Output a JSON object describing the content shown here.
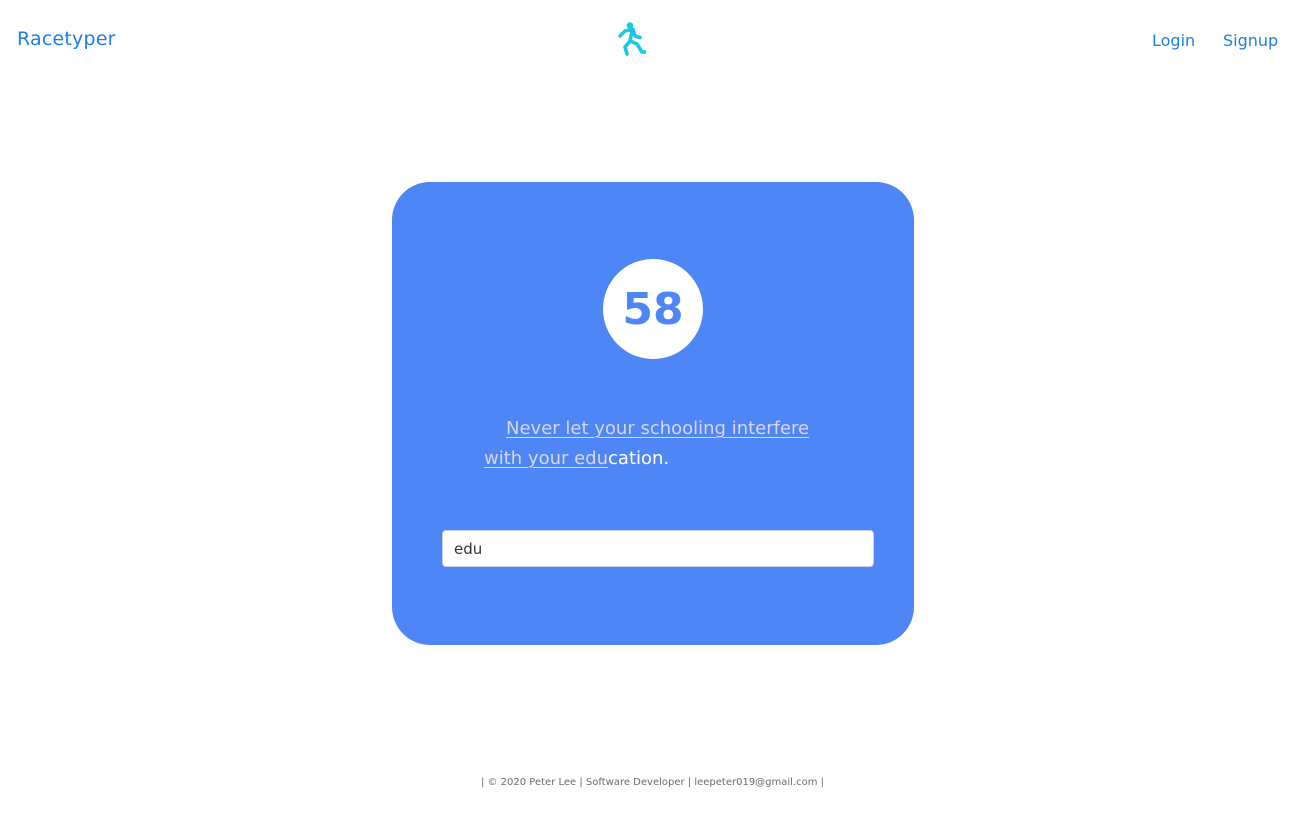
{
  "header": {
    "brand": "Racetyper",
    "logo_icon": "running-person-icon",
    "nav": {
      "login": "Login",
      "signup": "Signup"
    }
  },
  "race": {
    "countdown": "58",
    "quote_typed": "Never let your schooling interfere with your edu",
    "quote_remaining": "cation.",
    "input_value": "edu"
  },
  "footer": {
    "text": "| © 2020 Peter Lee | Software Developer | leepeter019@gmail.com |"
  },
  "colors": {
    "brand": "#1c7fe6",
    "card_bg": "#4e86f5",
    "logo": "#19c7e8",
    "typed_text": "#d9d6f0"
  }
}
